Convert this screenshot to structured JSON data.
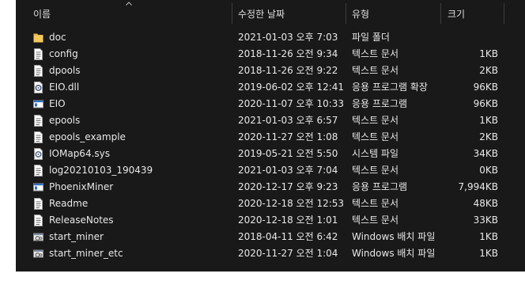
{
  "columns": {
    "name": "이름",
    "date": "수정한 날짜",
    "type": "유형",
    "size": "크기"
  },
  "files": [
    {
      "name": "doc",
      "date": "2021-01-03 오후 7:03",
      "type": "파일 폴더",
      "size": "",
      "icon": "folder-icon"
    },
    {
      "name": "config",
      "date": "2018-11-26 오전 9:34",
      "type": "텍스트 문서",
      "size": "1KB",
      "icon": "text-document-icon"
    },
    {
      "name": "dpools",
      "date": "2018-11-26 오전 9:22",
      "type": "텍스트 문서",
      "size": "2KB",
      "icon": "text-document-icon"
    },
    {
      "name": "EIO.dll",
      "date": "2019-06-02 오후 12:41",
      "type": "응용 프로그램 확장",
      "size": "96KB",
      "icon": "dll-gear-icon"
    },
    {
      "name": "EIO",
      "date": "2020-11-07 오후 10:33",
      "type": "응용 프로그램",
      "size": "96KB",
      "icon": "application-window-icon"
    },
    {
      "name": "epools",
      "date": "2021-01-03 오후 6:57",
      "type": "텍스트 문서",
      "size": "1KB",
      "icon": "text-document-icon"
    },
    {
      "name": "epools_example",
      "date": "2020-11-27 오전 1:08",
      "type": "텍스트 문서",
      "size": "2KB",
      "icon": "text-document-icon"
    },
    {
      "name": "IOMap64.sys",
      "date": "2019-05-21 오전 5:50",
      "type": "시스템 파일",
      "size": "34KB",
      "icon": "system-file-gear-icon"
    },
    {
      "name": "log20210103_190439",
      "date": "2021-01-03 오후 7:04",
      "type": "텍스트 문서",
      "size": "0KB",
      "icon": "text-document-icon"
    },
    {
      "name": "PhoenixMiner",
      "date": "2020-12-17 오후 9:23",
      "type": "응용 프로그램",
      "size": "7,994KB",
      "icon": "application-window-icon"
    },
    {
      "name": "Readme",
      "date": "2020-12-18 오전 12:53",
      "type": "텍스트 문서",
      "size": "48KB",
      "icon": "text-document-icon"
    },
    {
      "name": "ReleaseNotes",
      "date": "2020-12-18 오전 1:01",
      "type": "텍스트 문서",
      "size": "33KB",
      "icon": "text-document-icon"
    },
    {
      "name": "start_miner",
      "date": "2018-04-11 오전 6:42",
      "type": "Windows 배치 파일",
      "size": "1KB",
      "icon": "batch-file-gear-icon"
    },
    {
      "name": "start_miner_etc",
      "date": "2020-11-27 오전 1:04",
      "type": "Windows 배치 파일",
      "size": "1KB",
      "icon": "batch-file-gear-icon"
    }
  ],
  "colors": {
    "background": "#191919",
    "text": "#e8e8e8",
    "header_text": "#dedede",
    "folder": "#e8b84a",
    "app_blue": "#2f6fbf"
  }
}
